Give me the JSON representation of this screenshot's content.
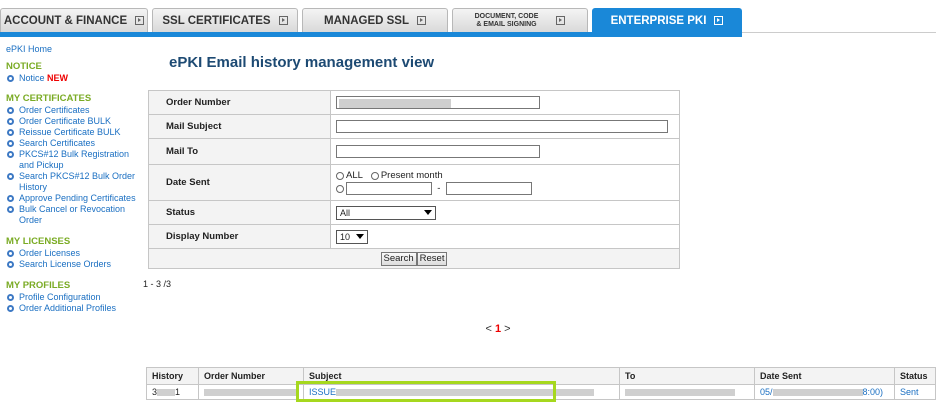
{
  "tabs": [
    {
      "label": "ACCOUNT & FINANCE"
    },
    {
      "label": "SSL CERTIFICATES"
    },
    {
      "label": "MANAGED SSL"
    },
    {
      "line1": "DOCUMENT, CODE",
      "line2": "& EMAIL SIGNING"
    },
    {
      "label": "ENTERPRISE PKI"
    }
  ],
  "sidebar": {
    "home": "ePKI Home",
    "notice_head": "NOTICE",
    "notice_item": "Notice",
    "notice_new": "NEW",
    "certs_head": "MY CERTIFICATES",
    "certs": [
      "Order Certificates",
      "Order Certificate BULK",
      "Reissue Certificate BULK",
      "Search Certificates",
      "PKCS#12 Bulk Registration and Pickup",
      "Search PKCS#12 Bulk Order History",
      "Approve Pending Certificates",
      "Bulk Cancel or Revocation Order"
    ],
    "licenses_head": "MY LICENSES",
    "licenses": [
      "Order Licenses",
      "Search License Orders"
    ],
    "profiles_head": "MY PROFILES",
    "profiles": [
      "Profile Configuration",
      "Order Additional Profiles"
    ]
  },
  "page_title": "ePKI Email history management view",
  "form": {
    "order_number": "Order Number",
    "mail_subject": "Mail Subject",
    "mail_to": "Mail To",
    "date_sent": "Date Sent",
    "opt_all": "ALL",
    "opt_month": "Present month",
    "dash": "-",
    "status": "Status",
    "status_value": "All",
    "display_number": "Display Number",
    "display_value": "10",
    "search": "Search",
    "reset": "Reset"
  },
  "result_count": "1 - 3 /3",
  "pager": {
    "prev": "<",
    "current": "1",
    "next": ">"
  },
  "table": {
    "headers": [
      "History",
      "Order Number",
      "Subject",
      "To",
      "Date Sent",
      "Status"
    ],
    "row": {
      "history": "3",
      "history_tail": "1",
      "subject": "ISSUE",
      "date_prefix": "05/",
      "date_suffix": "8:00)",
      "status": "Sent"
    }
  }
}
